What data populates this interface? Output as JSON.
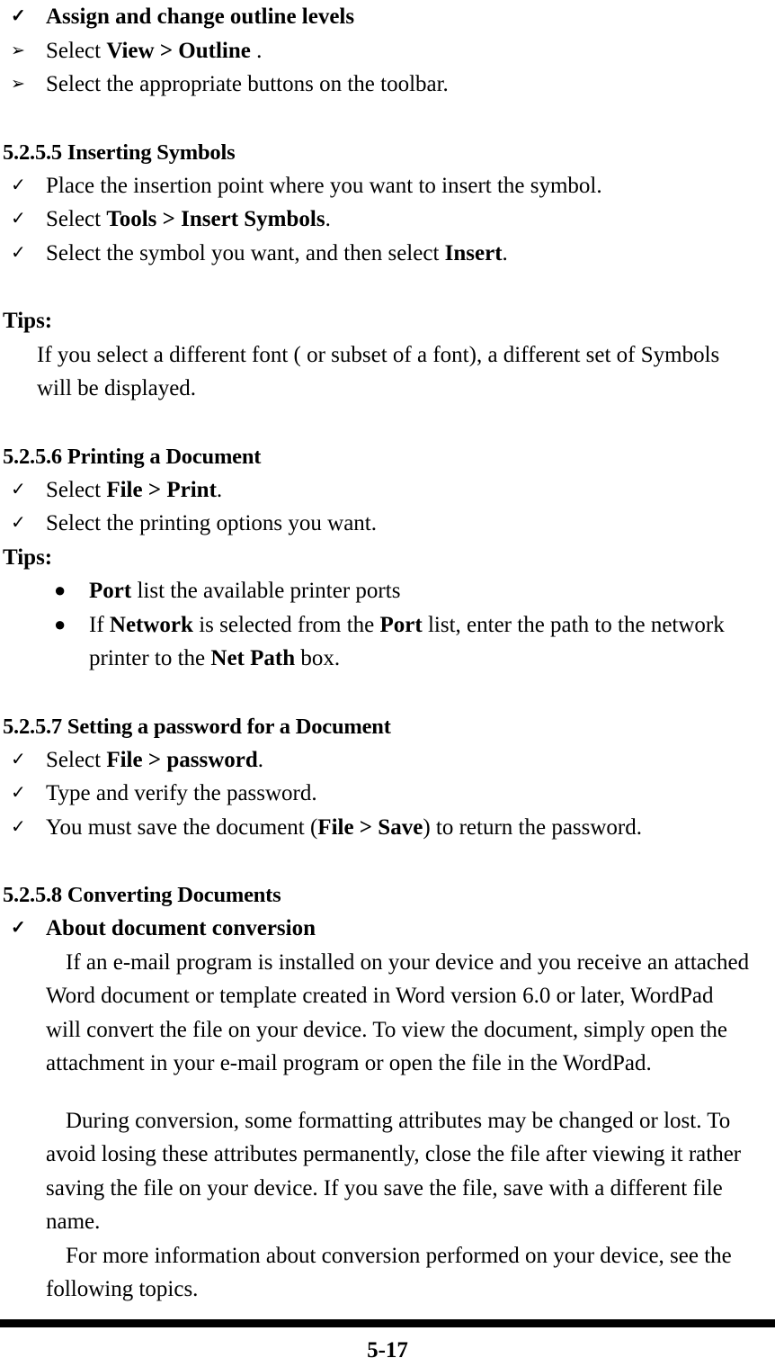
{
  "document": {
    "page_number": "5-17",
    "markers": {
      "check": "✓",
      "arrow": "➢",
      "dot": "●"
    },
    "blocks": [
      {
        "id": "outline-levels-heading",
        "text": "Assign and change outline levels"
      },
      {
        "id": "outline-select-view",
        "text_parts": [
          "Select ",
          "View > Outline",
          " ."
        ]
      },
      {
        "id": "outline-select-buttons",
        "text": "Select the appropriate buttons on the toolbar."
      },
      {
        "id": "sec-5255-heading",
        "text": "5.2.5.5 Inserting Symbols"
      },
      {
        "id": "symbols-place-point",
        "text": "Place the insertion point where you want to insert the symbol."
      },
      {
        "id": "symbols-select-tools",
        "text_parts": [
          "Select ",
          "Tools > Insert Symbols",
          "."
        ]
      },
      {
        "id": "symbols-select-symbol",
        "text_parts": [
          "Select the symbol you want, and then select ",
          "Insert",
          "."
        ]
      },
      {
        "id": "tips-1-label",
        "text": "Tips:"
      },
      {
        "id": "tips-1-body",
        "text": "If you select a different font ( or subset of a font), a different set of Symbols will be displayed."
      },
      {
        "id": "sec-5256-heading",
        "text": "5.2.5.6 Printing a Document"
      },
      {
        "id": "print-select-file",
        "text_parts": [
          "Select ",
          "File > Print",
          "."
        ]
      },
      {
        "id": "print-options",
        "text": "Select the printing options you want."
      },
      {
        "id": "tips-2-label",
        "text": "Tips:"
      },
      {
        "id": "tips-2-port",
        "text_parts": [
          "Port",
          " list the available printer ports"
        ]
      },
      {
        "id": "tips-2-network",
        "text_parts": [
          "If ",
          "Network",
          " is selected from the ",
          "Port",
          " list, enter the path to the network printer to the ",
          "Net Path",
          " box."
        ]
      },
      {
        "id": "sec-5257-heading",
        "text": "5.2.5.7 Setting a password for a Document"
      },
      {
        "id": "password-select-file",
        "text_parts": [
          "Select ",
          "File > password",
          "."
        ]
      },
      {
        "id": "password-type-verify",
        "text": "Type and verify the password."
      },
      {
        "id": "password-save-doc",
        "text_parts": [
          "You must save the document (",
          "File > Save",
          ") to return the password."
        ]
      },
      {
        "id": "sec-5258-heading",
        "text": "5.2.5.8 Converting Documents"
      },
      {
        "id": "about-conversion-heading",
        "text": "About document conversion"
      },
      {
        "id": "conversion-para-1",
        "text": "If an e-mail program is installed on your device and you receive an attached Word document or template created in Word version 6.0 or later, WordPad will convert the file on your device. To view the document, simply open the attachment in your e-mail program or open the file in the WordPad."
      },
      {
        "id": "conversion-para-2",
        "text": "During conversion, some formatting attributes may be changed or lost. To avoid losing these attributes permanently, close the file after viewing it rather saving the file on your device. If you save the file, save with a different file name."
      },
      {
        "id": "conversion-para-3",
        "text": "For more information about conversion performed on your device, see the following topics."
      }
    ]
  }
}
